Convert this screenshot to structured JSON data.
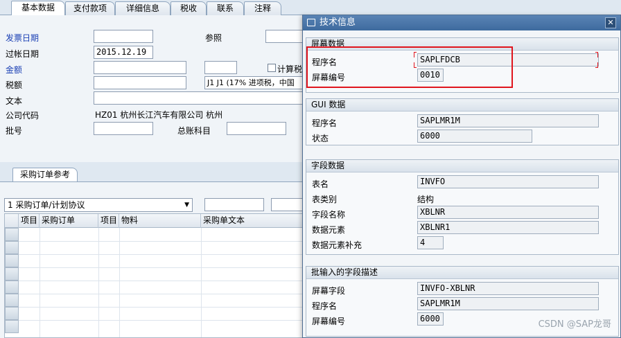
{
  "tabs": [
    "基本数据",
    "支付款项",
    "详细信息",
    "税收",
    "联系",
    "注释"
  ],
  "header": {
    "invoice_date_label": "发票日期",
    "reference_label": "参照",
    "posting_date_label": "过帐日期",
    "posting_date_value": "2015.12.19",
    "amount_label": "金额",
    "calc_tax_label": "计算税",
    "tax_amount_label": "税额",
    "tax_code_value": "J1 J1 (17% 进项税，中国",
    "text_label": "文本",
    "company_code_label": "公司代码",
    "company_code_value": "HZ01 杭州长江汽车有限公司 杭州",
    "batch_label": "批号",
    "gl_account_label": "总账科目"
  },
  "po_reference": {
    "tab_label": "采购订单参考",
    "select_value": "1 采购订单/计划协议",
    "columns": [
      "项目",
      "采购订单",
      "项目",
      "物料",
      "采购单文本"
    ]
  },
  "dialog": {
    "title": "技术信息",
    "close_label": "✕",
    "screen_data": {
      "title": "屏幕数据",
      "program_label": "程序名",
      "program_value": "SAPLFDCB",
      "screen_no_label": "屏幕编号",
      "screen_no_value": "0010"
    },
    "gui_data": {
      "title": "GUI 数据",
      "program_label": "程序名",
      "program_value": "SAPLMR1M",
      "status_label": "状态",
      "status_value": "6000"
    },
    "field_data": {
      "title": "字段数据",
      "table_label": "表名",
      "table_value": "INVFO",
      "table_type_label": "表类别",
      "table_type_value": "结构",
      "field_name_label": "字段名称",
      "field_name_value": "XBLNR",
      "data_element_label": "数据元素",
      "data_element_value": "XBLNR1",
      "dtel_suppl_label": "数据元素补充",
      "dtel_suppl_value": "4"
    },
    "batch_input": {
      "title": "批输入的字段描述",
      "screen_field_label": "屏幕字段",
      "screen_field_value": "INVFO-XBLNR",
      "program_label": "程序名",
      "program_value": "SAPLMR1M",
      "screen_no_label": "屏幕编号",
      "screen_no_value": "6000"
    }
  },
  "watermark": "CSDN @SAP龙哥",
  "colors": {
    "label_blue": "#1a3fb4",
    "title_bar": "#3e6a9e",
    "highlight_red": "#e0141c"
  }
}
